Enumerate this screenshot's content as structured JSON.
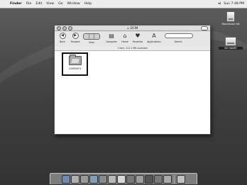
{
  "menubar": {
    "apple_glyph": "",
    "items": [
      "Finder",
      "File",
      "Edit",
      "View",
      "Go",
      "Window",
      "Help"
    ],
    "volume_icon": "speaker-icon",
    "clock": "Sun 7:48 PM"
  },
  "desktop": {
    "volumes": [
      {
        "label": "Macintosh HD",
        "icon": "hard-disk-icon"
      },
      {
        "label": "NO NAME",
        "icon": "camera-card-volume-icon"
      }
    ]
  },
  "window": {
    "title": "DCIM",
    "toolbar": [
      {
        "label": "Back",
        "icon": "back-arrow-icon",
        "glyph": "◀"
      },
      {
        "label": "Forward",
        "icon": "forward-arrow-icon",
        "glyph": "▶"
      },
      {
        "label": "View",
        "icon": "view-mode-icon",
        "glyph": ""
      },
      {
        "label": "Computer",
        "icon": "computer-icon",
        "glyph": "▤"
      },
      {
        "label": "Home",
        "icon": "home-icon",
        "glyph": "⌂"
      },
      {
        "label": "Favorites",
        "icon": "favorites-icon",
        "glyph": "♥"
      },
      {
        "label": "Applications",
        "icon": "applications-icon",
        "glyph": "A"
      },
      {
        "label": "Search",
        "icon": "search-icon",
        "glyph": ""
      }
    ],
    "status": "1 item, 222.2 MB available",
    "items": [
      {
        "label": "100PENTX",
        "icon": "folder-icon"
      }
    ]
  },
  "dock": {
    "items": [
      "finder-icon",
      "mail-icon",
      "chat-icon",
      "browser-icon",
      "music-icon",
      "dvd-icon",
      "calendar-icon",
      "imovie-icon",
      "iphoto-icon",
      "clapper-icon",
      "itunes-icon",
      "preferences-icon",
      "trash-icon"
    ],
    "colors": [
      "#6c8cb4",
      "#b0b0b0",
      "#9a9a9a",
      "#7f9fbf",
      "#8a8a8a",
      "#b9b9b9",
      "#d8d8d8",
      "#777777",
      "#9d9d9d",
      "#555555",
      "#7a7a7a",
      "#aaaaaa",
      "#c0c0c0"
    ]
  }
}
